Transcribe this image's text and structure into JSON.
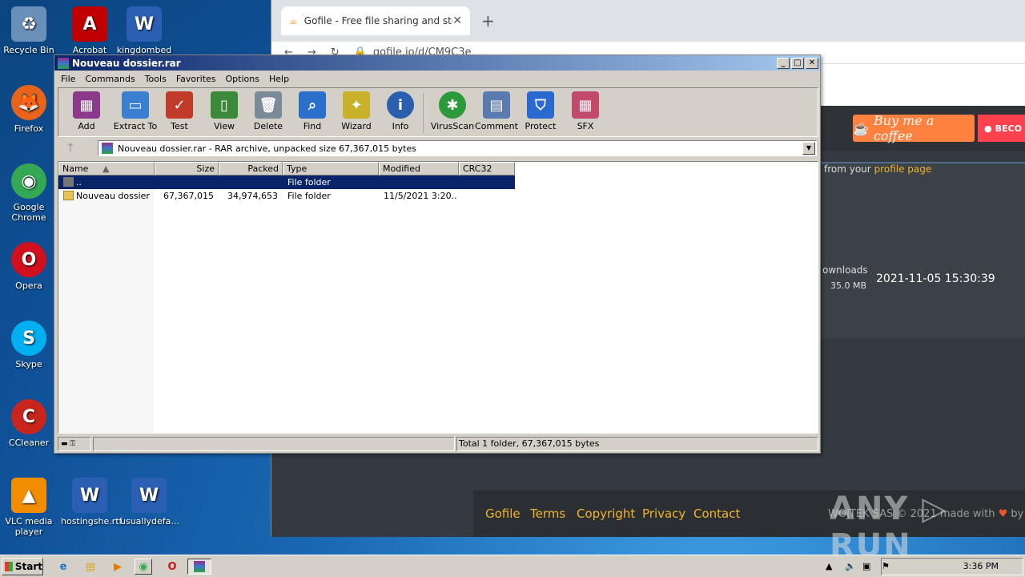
{
  "desktop": {
    "icons": [
      {
        "label": "Recycle Bin",
        "color": "#6a8fb8",
        "glyph": "♻"
      },
      {
        "label": "Acrobat",
        "color": "#c00000",
        "glyph": "A"
      },
      {
        "label": "kingdombed",
        "color": "#2b5fb3",
        "glyph": "W"
      },
      {
        "label": "Firefox",
        "color": "#e8641b",
        "glyph": "🦊"
      },
      {
        "label": "Google Chrome",
        "color": "#34a853",
        "glyph": "◉"
      },
      {
        "label": "Opera",
        "color": "#d0101e",
        "glyph": "O"
      },
      {
        "label": "Skype",
        "color": "#00aff0",
        "glyph": "S"
      },
      {
        "label": "CCleaner",
        "color": "#c8261d",
        "glyph": "C"
      },
      {
        "label": "VLC media player",
        "color": "#f28c00",
        "glyph": "▲"
      },
      {
        "label": "hostingshe.rtf",
        "color": "#2b5fb3",
        "glyph": "W"
      },
      {
        "label": "usuallydefa...",
        "color": "#2b5fb3",
        "glyph": "W"
      }
    ]
  },
  "browser": {
    "tab_title": "Gofile - Free file sharing and storage",
    "url": "gofile.io/d/CM9C3e",
    "buy_coffee": "Buy me a coffee",
    "become": "BECO",
    "profile_text": "from your",
    "profile_link": "profile page",
    "downloads_label": "ownloads",
    "size": "35.0 MB",
    "date": "2021-11-05 15:30:39",
    "footer_links": [
      "Gofile",
      "Terms",
      "Copyright",
      "Privacy",
      "Contact"
    ],
    "footer_copy": "WOJTEK SAS © 2021 made with",
    "footer_by": "by",
    "watermark": "ANY ▷ RUN"
  },
  "winrar": {
    "title": "Nouveau dossier.rar",
    "menu": [
      "File",
      "Commands",
      "Tools",
      "Favorites",
      "Options",
      "Help"
    ],
    "tools": [
      {
        "label": "Add",
        "color": "#8b3a8b",
        "glyph": "▦"
      },
      {
        "label": "Extract To",
        "color": "#3a7fd0",
        "glyph": "▭"
      },
      {
        "label": "Test",
        "color": "#c23a2a",
        "glyph": "✓"
      },
      {
        "label": "View",
        "color": "#3a8a3a",
        "glyph": "▯"
      },
      {
        "label": "Delete",
        "color": "#7a8a99",
        "glyph": "🗑"
      },
      {
        "label": "Find",
        "color": "#2a6fc9",
        "glyph": "⌕"
      },
      {
        "label": "Wizard",
        "color": "#c9b12a",
        "glyph": "✦"
      },
      {
        "label": "Info",
        "color": "#2a5fb0",
        "glyph": "i"
      },
      {
        "label": "VirusScan",
        "color": "#2a9a3a",
        "glyph": "✱"
      },
      {
        "label": "Comment",
        "color": "#5a7ab0",
        "glyph": "▤"
      },
      {
        "label": "Protect",
        "color": "#2a6ad0",
        "glyph": "⛉"
      },
      {
        "label": "SFX",
        "color": "#c24a6a",
        "glyph": "▦"
      }
    ],
    "path": "Nouveau dossier.rar - RAR archive, unpacked size 67,367,015 bytes",
    "columns": [
      "Name",
      "Size",
      "Packed",
      "Type",
      "Modified",
      "CRC32"
    ],
    "rows": [
      {
        "name": "..",
        "size": "",
        "packed": "",
        "type": "File folder",
        "modified": "",
        "crc": ""
      },
      {
        "name": "Nouveau dossier",
        "size": "67,367,015",
        "packed": "34,974,653",
        "type": "File folder",
        "modified": "11/5/2021 3:20...",
        "crc": ""
      }
    ],
    "status_left": "▬ ⚿",
    "status_right": "Total 1 folder, 67,367,015 bytes"
  },
  "taskbar": {
    "start": "Start",
    "clock": "3:36 PM"
  }
}
